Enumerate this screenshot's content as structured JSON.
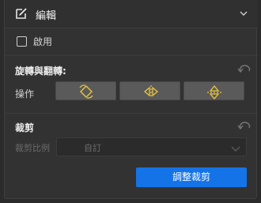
{
  "header": {
    "title": "編輯",
    "icon": "edit-square-icon"
  },
  "enable": {
    "label": "啟用",
    "checked": false
  },
  "rotate_flip": {
    "title": "旋轉與翻轉:",
    "row_label": "操作",
    "buttons": [
      "rotate-icon",
      "flip-horizontal-icon",
      "flip-vertical-icon"
    ]
  },
  "crop": {
    "title": "裁剪",
    "ratio_label": "裁剪比例",
    "ratio_value": "自訂",
    "apply_label": "調整裁剪"
  },
  "colors": {
    "accent": "#1473e6",
    "icon_gold": "#e8c640",
    "panel": "#323232",
    "button": "#5a5a5a"
  }
}
